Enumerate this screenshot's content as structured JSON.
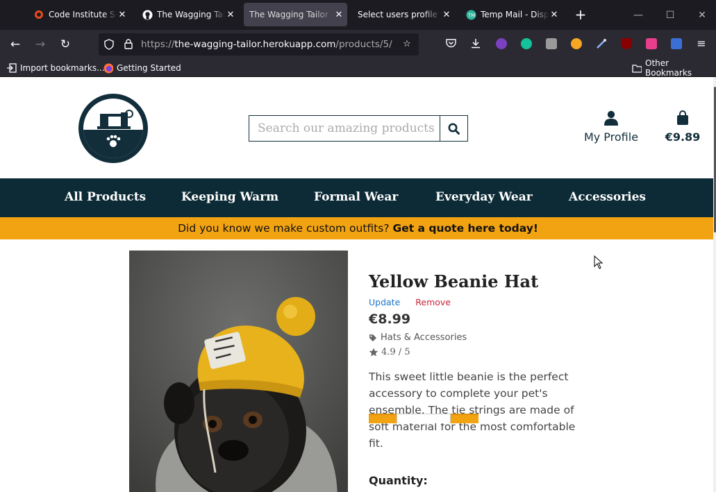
{
  "browser": {
    "tabs": [
      {
        "label": "Code Institute Scho",
        "icon": "code-institute-icon"
      },
      {
        "label": "The Wagging Tailor",
        "icon": "github-icon"
      },
      {
        "label": "The Wagging Tailor - Y",
        "icon": "none",
        "active": true
      },
      {
        "label": "Select users profile to",
        "icon": "none"
      },
      {
        "label": "Temp Mail - Dispo",
        "icon": "temp-mail-icon"
      }
    ],
    "url_scheme": "https://",
    "url_host": "the-wagging-tailor.herokuapp.com",
    "url_path": "/products/5/",
    "bookmarks": [
      "Import bookmarks...",
      "Getting Started"
    ],
    "other_bookmarks": "Other Bookmarks"
  },
  "site": {
    "search_placeholder": "Search our amazing products",
    "profile_label": "My Profile",
    "bag_total": "€9.89",
    "nav": [
      "All Products",
      "Keeping Warm",
      "Formal Wear",
      "Everyday Wear",
      "Accessories"
    ],
    "banner_text": "Did you know we make custom outfits? ",
    "banner_link": "Get a quote here today!"
  },
  "product": {
    "title": "Yellow Beanie Hat",
    "update_label": "Update",
    "remove_label": "Remove",
    "price": "€8.99",
    "category": "Hats & Accessories",
    "rating": "4.9 / 5",
    "description": "This sweet little beanie is the perfect accessory to complete your pet's ensemble. The tie strings are made of soft material for the most comfortable fit.",
    "quantity_label": "Quantity:"
  },
  "colors": {
    "brand_dark": "#0d2b36",
    "accent_orange": "#f2a312",
    "update_blue": "#1a73c8",
    "remove_red": "#c8233a"
  }
}
